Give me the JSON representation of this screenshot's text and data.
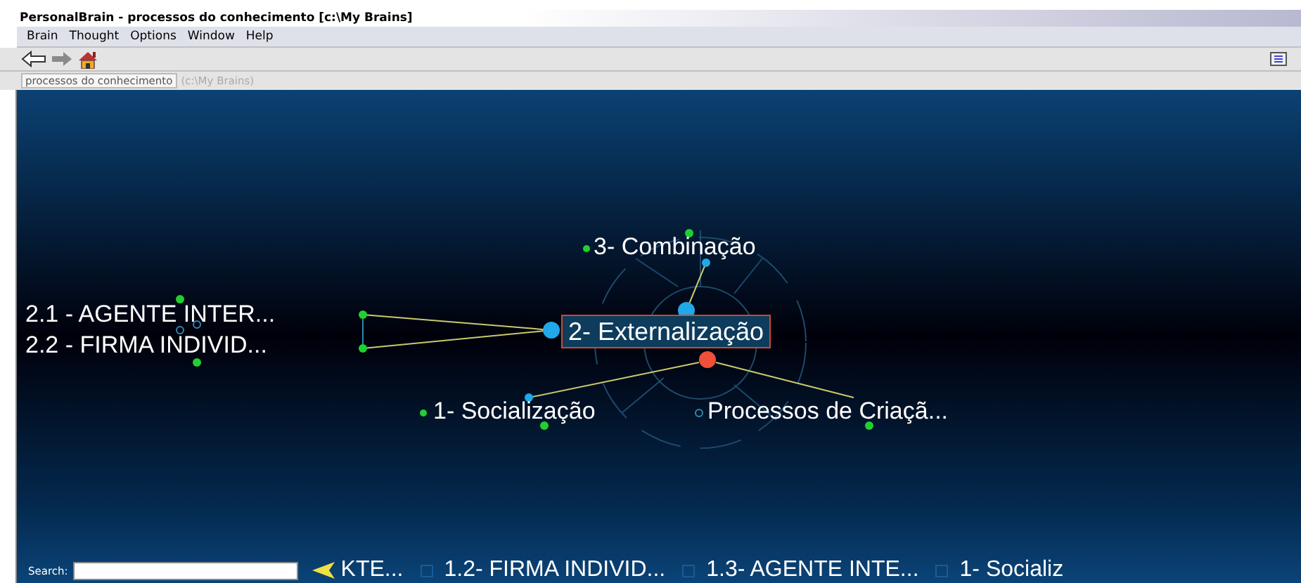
{
  "window": {
    "title": "PersonalBrain - processos do conhecimento [c:\\My Brains]"
  },
  "menu": [
    "Brain",
    "Thought",
    "Options",
    "Window",
    "Help"
  ],
  "tab": {
    "label": "processos do conhecimento",
    "path": "(c:\\My Brains)"
  },
  "nodes": [
    {
      "kind": "thought",
      "label": "3- Combinação"
    },
    {
      "kind": "thought",
      "label": "2.1 - AGENTE INTER..."
    },
    {
      "kind": "thought",
      "label": "2.2 - FIRMA INDIVID..."
    },
    {
      "kind": "active",
      "label": "2- Externalização"
    },
    {
      "kind": "thought",
      "label": "1- Socialização"
    },
    {
      "kind": "jump",
      "label": "Processos de Criaçã..."
    }
  ],
  "search": {
    "label": "Search:"
  },
  "history": [
    "KTE...",
    "1.2- FIRMA INDIVID...",
    "1.3- AGENTE INTE...",
    "1- Socializ"
  ]
}
